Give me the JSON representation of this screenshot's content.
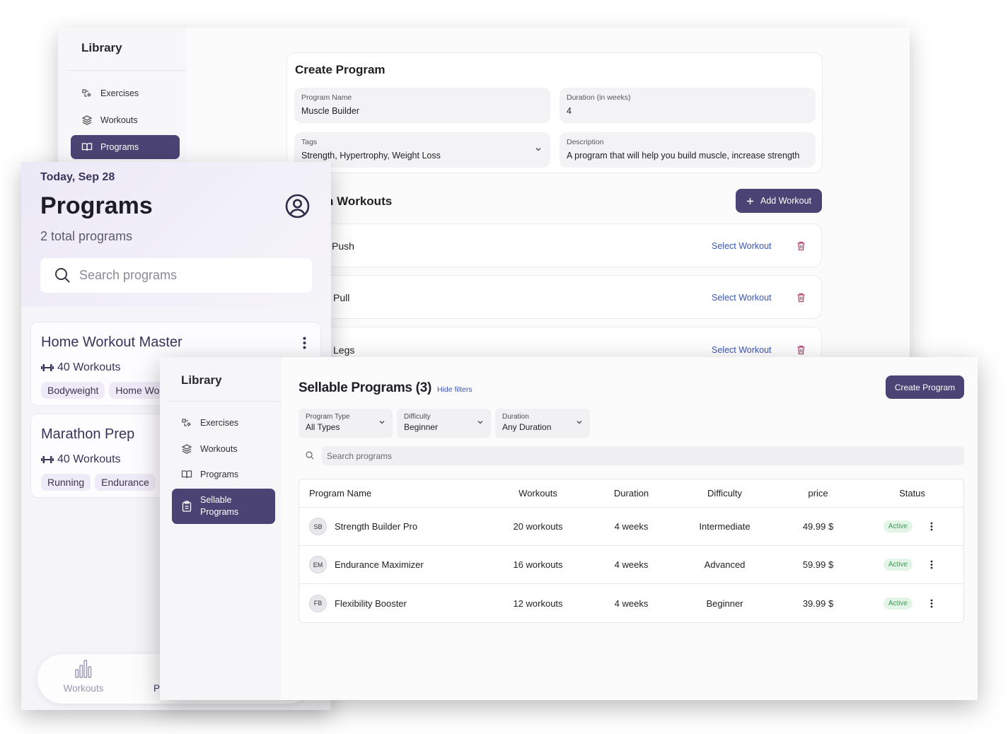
{
  "back_window": {
    "sidebar": {
      "title": "Library",
      "items": [
        {
          "label": "Exercises",
          "icon": "exercises-icon",
          "active": false
        },
        {
          "label": "Workouts",
          "icon": "layers-icon",
          "active": false
        },
        {
          "label": "Programs",
          "icon": "book-open-icon",
          "active": true
        }
      ]
    },
    "create_program": {
      "title": "Create Program",
      "fields": {
        "program_name": {
          "label": "Program Name",
          "value": "Muscle Builder"
        },
        "duration": {
          "label": "Duration (in weeks)",
          "value": "4"
        },
        "tags": {
          "label": "Tags",
          "value": "Strength, Hypertrophy, Weight Loss"
        },
        "description": {
          "label": "Description",
          "value": "A program that will help you build muscle, increase strength"
        }
      }
    },
    "workouts_section": {
      "title_visible": "n Workouts",
      "add_button": "Add Workout",
      "rows": [
        {
          "name": "Push",
          "action": "Select Workout"
        },
        {
          "name": "Pull",
          "action": "Select Workout"
        },
        {
          "name": "Legs",
          "action": "Select Workout"
        }
      ]
    }
  },
  "mobile": {
    "date": "Today, Sep 28",
    "title": "Programs",
    "subtitle": "2 total programs",
    "search_placeholder": "Search programs",
    "programs": [
      {
        "name": "Home Workout Master",
        "workouts": "40 Workouts",
        "tags": [
          "Bodyweight",
          "Home Wo"
        ]
      },
      {
        "name": "Marathon Prep",
        "workouts": "40 Workouts",
        "tags": [
          "Running",
          "Endurance"
        ]
      }
    ],
    "bottom_nav": {
      "workouts_label": "Workouts",
      "second_label_visible": "P"
    }
  },
  "front_window": {
    "sidebar": {
      "title": "Library",
      "items": [
        {
          "label": "Exercises",
          "icon": "exercises-icon",
          "active": false
        },
        {
          "label": "Workouts",
          "icon": "layers-icon",
          "active": false
        },
        {
          "label": "Programs",
          "icon": "book-open-icon",
          "active": false
        },
        {
          "label_line1": "Sellable",
          "label_line2": "Programs",
          "icon": "clipboard-icon",
          "active": true
        }
      ]
    },
    "header": {
      "title": "Sellable Programs (3)",
      "hide_filters": "Hide filters",
      "create_button": "Create Program"
    },
    "filters": [
      {
        "label": "Program Type",
        "value": "All Types"
      },
      {
        "label": "Difficulty",
        "value": "Beginner"
      },
      {
        "label": "Duration",
        "value": "Any Duration"
      }
    ],
    "search_placeholder": "Search programs",
    "table": {
      "columns": [
        "Program Name",
        "Workouts",
        "Duration",
        "Difficulty",
        "price",
        "Status"
      ],
      "rows": [
        {
          "initials": "SB",
          "name": "Strength Builder Pro",
          "workouts": "20 workouts",
          "duration": "4 weeks",
          "difficulty": "Intermediate",
          "price": "49.99 $",
          "status": "Active"
        },
        {
          "initials": "EM",
          "name": "Endurance Maximizer",
          "workouts": "16 workouts",
          "duration": "4 weeks",
          "difficulty": "Advanced",
          "price": "59.99 $",
          "status": "Active"
        },
        {
          "initials": "FB",
          "name": "Flexibility Booster",
          "workouts": "12 workouts",
          "duration": "4 weeks",
          "difficulty": "Beginner",
          "price": "39.99 $",
          "status": "Active"
        }
      ]
    }
  },
  "colors": {
    "accent": "#4b4373",
    "link": "#3a56b8",
    "status_active_bg": "#e2f5e6",
    "status_active_text": "#3f9a55",
    "danger": "#b0406a"
  }
}
